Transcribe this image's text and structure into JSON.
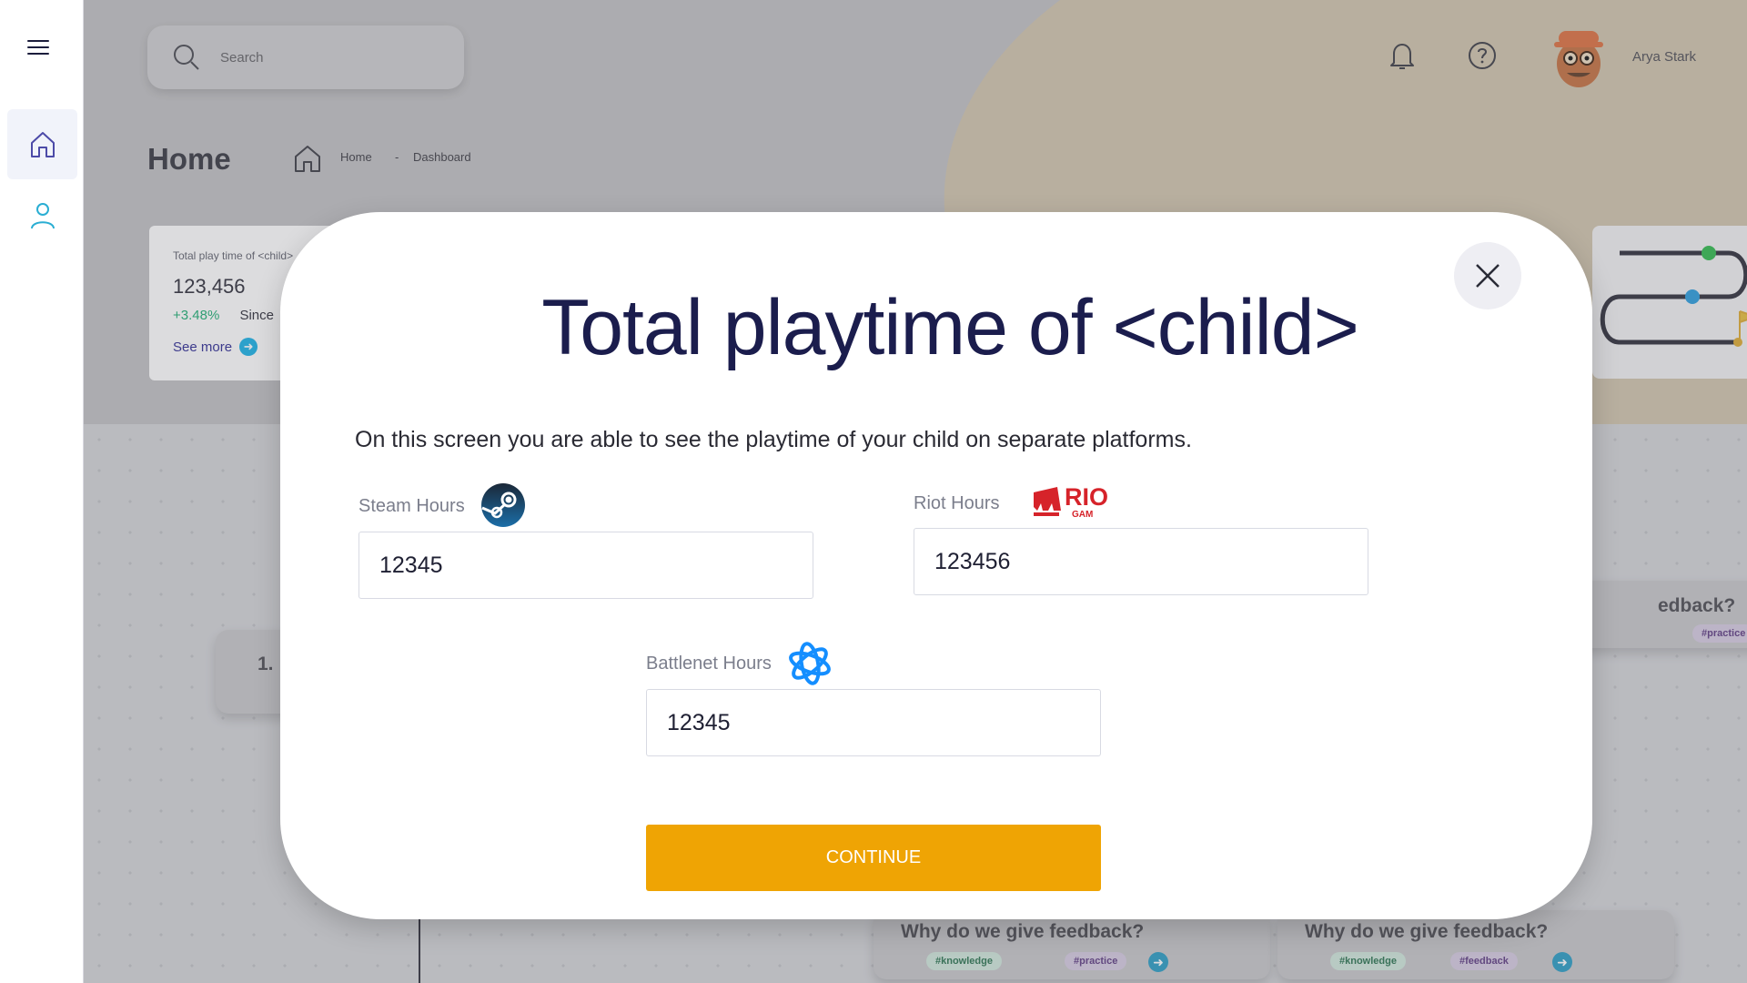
{
  "sidebar": {
    "menu_icon": "hamburger-icon",
    "items": [
      {
        "icon": "home-icon",
        "active": true
      },
      {
        "icon": "user-icon",
        "active": false
      }
    ]
  },
  "header": {
    "search_placeholder": "Search",
    "username": "Arya Stark"
  },
  "page": {
    "title": "Home",
    "breadcrumb": {
      "home": "Home",
      "separator": "-",
      "current": "Dashboard"
    }
  },
  "stat_card": {
    "label": "Total play time of <child>",
    "value": "123,456",
    "change": "+3.48%",
    "since": "Since",
    "link": "See more"
  },
  "background_nodes": {
    "step_number": "1.",
    "right_title": "edback?",
    "right_tag": "#practice",
    "bottom_cards": [
      {
        "title": "Why do we give feedback?",
        "tags": [
          "#knowledge",
          "#practice"
        ]
      },
      {
        "title": "Why do we give feedback?",
        "tags": [
          "#knowledge",
          "#feedback"
        ]
      }
    ]
  },
  "modal": {
    "title": "Total playtime of <child>",
    "description": "On this screen you are able to see the playtime of your child on separate platforms.",
    "fields": {
      "steam": {
        "label": "Steam Hours",
        "value": "12345"
      },
      "riot": {
        "label": "Riot Hours",
        "value": "123456",
        "logo_text": "RIO",
        "logo_sub": "GAM"
      },
      "battlenet": {
        "label": "Battlenet Hours",
        "value": "12345"
      }
    },
    "continue_label": "CONTINUE"
  },
  "colors": {
    "accent": "#efa404",
    "title": "#1b1d4d",
    "link": "#3d3b9c",
    "positive": "#2db47d"
  }
}
